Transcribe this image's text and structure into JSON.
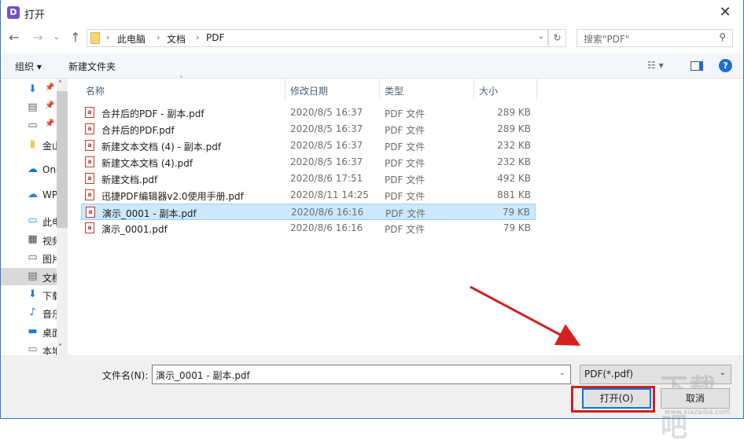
{
  "window": {
    "title": "打开",
    "app_icon": "D",
    "close": "✕"
  },
  "nav": {
    "breadcrumb": [
      "此电脑",
      "文档",
      "PDF"
    ],
    "search_placeholder": "搜索\"PDF\""
  },
  "toolbar": {
    "organize": "组织 ▾",
    "new_folder": "新建文件夹",
    "help": "?"
  },
  "sidebar": {
    "items": [
      {
        "label": "",
        "icon": "download-icon"
      },
      {
        "label": "",
        "icon": "document-icon"
      },
      {
        "label": "",
        "icon": "picture-icon"
      },
      {
        "label": "金山",
        "icon": "folder-icon"
      },
      {
        "label": "One",
        "icon": "onedrive-icon"
      },
      {
        "label": "WPS",
        "icon": "cloud-icon"
      },
      {
        "label": "此电",
        "icon": "computer-icon"
      },
      {
        "label": "视频",
        "icon": "video-icon"
      },
      {
        "label": "图片",
        "icon": "picture-icon"
      },
      {
        "label": "文档",
        "icon": "document-icon"
      },
      {
        "label": "下载",
        "icon": "download-icon"
      },
      {
        "label": "音乐",
        "icon": "music-icon"
      },
      {
        "label": "桌面",
        "icon": "desktop-icon"
      },
      {
        "label": "本地",
        "icon": "drive-icon"
      }
    ]
  },
  "columns": {
    "name": "名称",
    "date": "修改日期",
    "type": "类型",
    "size": "大小"
  },
  "files": [
    {
      "name": "合并后的PDF - 副本.pdf",
      "date": "2020/8/5 16:37",
      "type": "PDF 文件",
      "size": "289 KB"
    },
    {
      "name": "合并后的PDF.pdf",
      "date": "2020/8/5 16:37",
      "type": "PDF 文件",
      "size": "289 KB"
    },
    {
      "name": "新建文本文档 (4) - 副本.pdf",
      "date": "2020/8/5 16:37",
      "type": "PDF 文件",
      "size": "232 KB"
    },
    {
      "name": "新建文本文档 (4).pdf",
      "date": "2020/8/5 16:37",
      "type": "PDF 文件",
      "size": "232 KB"
    },
    {
      "name": "新建文档.pdf",
      "date": "2020/8/6 17:51",
      "type": "PDF 文件",
      "size": "492 KB"
    },
    {
      "name": "迅捷PDF编辑器v2.0使用手册.pdf",
      "date": "2020/8/11 14:25",
      "type": "PDF 文件",
      "size": "881 KB"
    },
    {
      "name": "演示_0001 - 副本.pdf",
      "date": "2020/8/6 16:16",
      "type": "PDF 文件",
      "size": "79 KB",
      "selected": true
    },
    {
      "name": "演示_0001.pdf",
      "date": "2020/8/6 16:16",
      "type": "PDF 文件",
      "size": "79 KB"
    }
  ],
  "footer": {
    "filename_label": "文件名(N):",
    "filename_value": "演示_0001 - 副本.pdf",
    "filter": "PDF(*.pdf)",
    "open": "打开(O)",
    "cancel": "取消"
  },
  "watermark": {
    "text": "下载吧",
    "url": "www.xiazaiba.com"
  },
  "colors": {
    "accent": "#0078d7",
    "highlight": "#d42020",
    "selection": "#cce8ff"
  }
}
